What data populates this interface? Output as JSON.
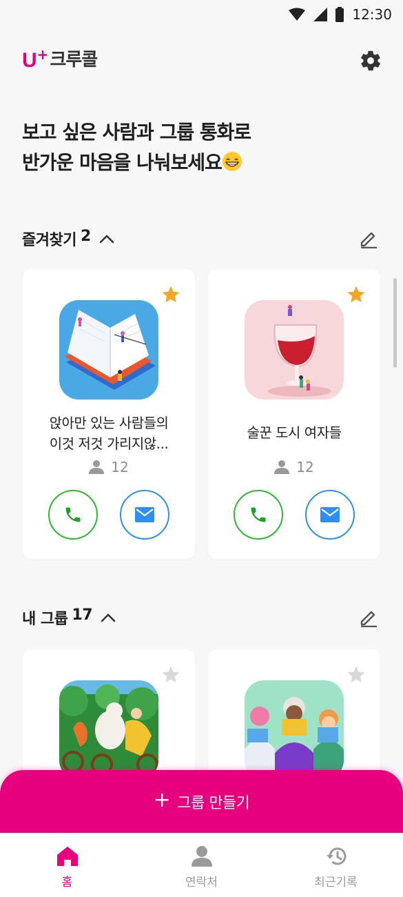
{
  "status_bar": {
    "time": "12:30"
  },
  "app": {
    "logo_u": "U",
    "logo_plus": "+",
    "logo_name": "크루콜",
    "settings_icon": "gear-icon"
  },
  "headline": {
    "line1": "보고 싶은 사람과 그룹 통화로",
    "line2": "반가운 마음을 나눠보세요"
  },
  "favorites": {
    "title": "즐겨찾기",
    "count": "2",
    "cards": [
      {
        "name_line1": "앉아만 있는 사람들의",
        "name_line2": "이것 저것 가리지않...",
        "members": "12",
        "starred": true,
        "thumb_color": "#4aa8e4"
      },
      {
        "name_line1": "술꾼 도시 여자들",
        "name_line2": "",
        "members": "12",
        "starred": true,
        "thumb_color": "#f8d7da"
      }
    ]
  },
  "my_groups": {
    "title": "내 그룹",
    "count": "17",
    "cards": [
      {
        "starred": false,
        "thumb_color": "#2e8b3a"
      },
      {
        "starred": false,
        "thumb_color": "#9ee3c8"
      }
    ]
  },
  "create_button": {
    "label": "그룹 만들기"
  },
  "nav": {
    "items": [
      {
        "label": "홈",
        "icon": "home-icon",
        "active": true
      },
      {
        "label": "연락처",
        "icon": "person-icon",
        "active": false
      },
      {
        "label": "최근기록",
        "icon": "history-icon",
        "active": false
      }
    ]
  },
  "colors": {
    "brand": "#e6007e",
    "call": "#2eb82e",
    "message": "#2f8ff0",
    "star_active": "#f5a623",
    "star_inactive": "#d9d9d9"
  }
}
